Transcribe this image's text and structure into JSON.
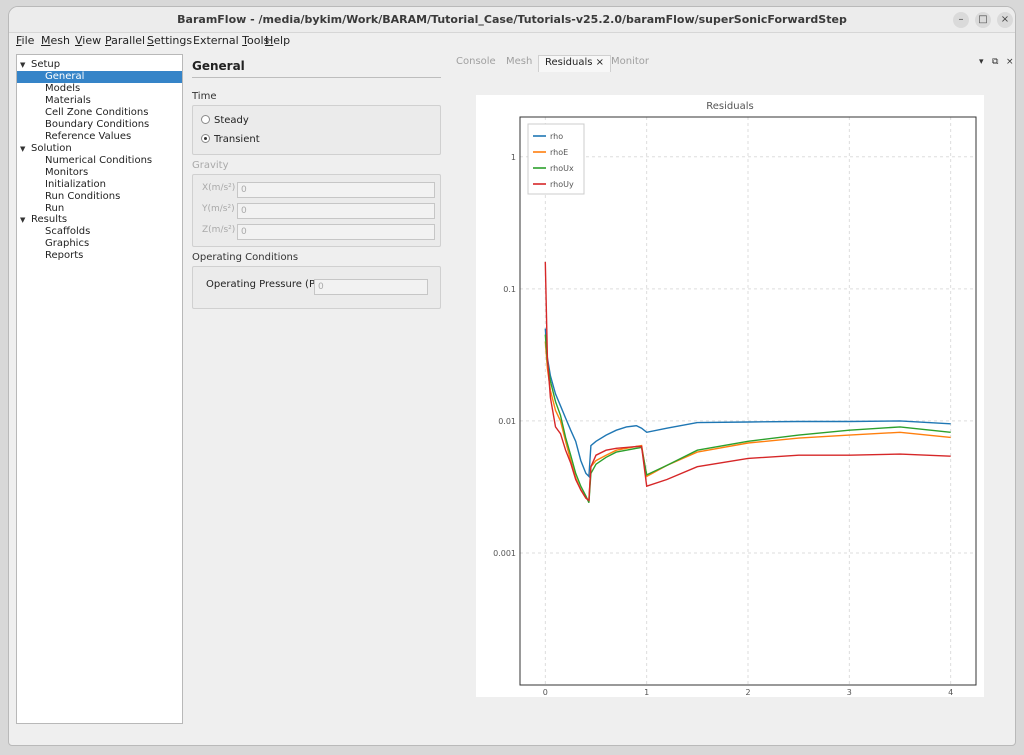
{
  "window": {
    "title": "BaramFlow - /media/bykim/Work/BARAM/Tutorial_Case/Tutorials-v25.2.0/baramFlow/superSonicForwardStep",
    "controls": {
      "minimize": "–",
      "maximize": "□",
      "close": "×"
    }
  },
  "menubar": [
    {
      "label": "File",
      "mnemonic": "F",
      "rest": "ile"
    },
    {
      "label": "Mesh",
      "mnemonic": "M",
      "rest": "esh"
    },
    {
      "label": "View",
      "mnemonic": "V",
      "rest": "iew"
    },
    {
      "label": "Parallel",
      "mnemonic": "P",
      "rest": "arallel"
    },
    {
      "label": "Settings",
      "mnemonic": "S",
      "rest": "ettings"
    },
    {
      "label": "External Tools",
      "pre": "External ",
      "mnemonic": "T",
      "rest": "ools"
    },
    {
      "label": "Help",
      "mnemonic": "H",
      "rest": "elp"
    }
  ],
  "tree": {
    "groups": [
      {
        "label": "Setup",
        "items": [
          "General",
          "Models",
          "Materials",
          "Cell Zone Conditions",
          "Boundary Conditions",
          "Reference Values"
        ]
      },
      {
        "label": "Solution",
        "items": [
          "Numerical Conditions",
          "Monitors",
          "Initialization",
          "Run Conditions",
          "Run"
        ]
      },
      {
        "label": "Results",
        "items": [
          "Scaffolds",
          "Graphics",
          "Reports"
        ]
      }
    ],
    "selected": "General"
  },
  "general": {
    "heading": "General",
    "time": {
      "label": "Time",
      "options": [
        "Steady",
        "Transient"
      ],
      "selected": "Transient"
    },
    "gravity": {
      "label": "Gravity",
      "fields": [
        {
          "label": "X(m/s²)",
          "value": "0"
        },
        {
          "label": "Y(m/s²)",
          "value": "0"
        },
        {
          "label": "Z(m/s²)",
          "value": "0"
        }
      ]
    },
    "operating": {
      "label": "Operating Conditions",
      "pressure_label": "Operating Pressure (Pa)",
      "pressure_value": "0"
    }
  },
  "tabs": {
    "items": [
      "Console",
      "Mesh",
      "Residuals",
      "Monitor"
    ],
    "active": "Residuals",
    "close_glyph": "×",
    "controls": [
      "▾",
      "⧉",
      "×"
    ]
  },
  "chart_data": {
    "type": "line",
    "title": "Residuals",
    "xlabel": "",
    "ylabel": "",
    "y_scale": "log",
    "xlim": [
      -0.25,
      4.25
    ],
    "ylim": [
      0.0001,
      2
    ],
    "x_ticks": [
      "0",
      "1",
      "2",
      "3",
      "4"
    ],
    "y_ticks": [
      "1",
      "0.1",
      "0.01",
      "0.001"
    ],
    "grid": true,
    "legend_position": "top-left",
    "series": [
      {
        "name": "rho",
        "color": "#1f77b4",
        "points": [
          [
            0,
            0.05
          ],
          [
            0.02,
            0.03
          ],
          [
            0.05,
            0.022
          ],
          [
            0.1,
            0.016
          ],
          [
            0.15,
            0.013
          ],
          [
            0.2,
            0.0105
          ],
          [
            0.25,
            0.0085
          ],
          [
            0.3,
            0.007
          ],
          [
            0.35,
            0.005
          ],
          [
            0.4,
            0.004
          ],
          [
            0.43,
            0.0038
          ],
          [
            0.45,
            0.0065
          ],
          [
            0.5,
            0.007
          ],
          [
            0.6,
            0.0078
          ],
          [
            0.7,
            0.0085
          ],
          [
            0.8,
            0.009
          ],
          [
            0.9,
            0.0092
          ],
          [
            0.95,
            0.0088
          ],
          [
            1.0,
            0.0082
          ],
          [
            1.2,
            0.0088
          ],
          [
            1.5,
            0.0097
          ],
          [
            2.0,
            0.0098
          ],
          [
            2.5,
            0.0099
          ],
          [
            3.0,
            0.0099
          ],
          [
            3.5,
            0.01
          ],
          [
            4.0,
            0.0095
          ]
        ]
      },
      {
        "name": "rhoE",
        "color": "#ff7f0e",
        "points": [
          [
            0,
            0.04
          ],
          [
            0.02,
            0.025
          ],
          [
            0.05,
            0.017
          ],
          [
            0.1,
            0.012
          ],
          [
            0.15,
            0.01
          ],
          [
            0.2,
            0.007
          ],
          [
            0.25,
            0.005
          ],
          [
            0.3,
            0.0037
          ],
          [
            0.35,
            0.003
          ],
          [
            0.4,
            0.0026
          ],
          [
            0.43,
            0.0025
          ],
          [
            0.45,
            0.0045
          ],
          [
            0.5,
            0.005
          ],
          [
            0.6,
            0.0055
          ],
          [
            0.7,
            0.006
          ],
          [
            0.8,
            0.0062
          ],
          [
            0.9,
            0.0064
          ],
          [
            0.95,
            0.0065
          ],
          [
            1.0,
            0.0038
          ],
          [
            1.2,
            0.0046
          ],
          [
            1.5,
            0.0058
          ],
          [
            2.0,
            0.0068
          ],
          [
            2.5,
            0.0074
          ],
          [
            3.0,
            0.0078
          ],
          [
            3.5,
            0.0082
          ],
          [
            4.0,
            0.0075
          ]
        ]
      },
      {
        "name": "rhoUx",
        "color": "#2ca02c",
        "points": [
          [
            0,
            0.045
          ],
          [
            0.02,
            0.028
          ],
          [
            0.05,
            0.02
          ],
          [
            0.1,
            0.014
          ],
          [
            0.15,
            0.011
          ],
          [
            0.2,
            0.0075
          ],
          [
            0.25,
            0.0055
          ],
          [
            0.3,
            0.004
          ],
          [
            0.35,
            0.0032
          ],
          [
            0.4,
            0.0027
          ],
          [
            0.43,
            0.0024
          ],
          [
            0.45,
            0.004
          ],
          [
            0.5,
            0.0047
          ],
          [
            0.6,
            0.0053
          ],
          [
            0.7,
            0.0058
          ],
          [
            0.8,
            0.006
          ],
          [
            0.9,
            0.0062
          ],
          [
            0.95,
            0.0063
          ],
          [
            1.0,
            0.0039
          ],
          [
            1.2,
            0.0046
          ],
          [
            1.5,
            0.006
          ],
          [
            2.0,
            0.007
          ],
          [
            2.5,
            0.0078
          ],
          [
            3.0,
            0.0085
          ],
          [
            3.5,
            0.009
          ],
          [
            4.0,
            0.0082
          ]
        ]
      },
      {
        "name": "rhoUy",
        "color": "#d62728",
        "points": [
          [
            0,
            0.16
          ],
          [
            0.02,
            0.03
          ],
          [
            0.05,
            0.015
          ],
          [
            0.1,
            0.009
          ],
          [
            0.15,
            0.008
          ],
          [
            0.2,
            0.006
          ],
          [
            0.25,
            0.0048
          ],
          [
            0.3,
            0.0036
          ],
          [
            0.35,
            0.003
          ],
          [
            0.4,
            0.0026
          ],
          [
            0.43,
            0.0025
          ],
          [
            0.45,
            0.0045
          ],
          [
            0.5,
            0.0055
          ],
          [
            0.6,
            0.006
          ],
          [
            0.7,
            0.0062
          ],
          [
            0.8,
            0.0063
          ],
          [
            0.9,
            0.0064
          ],
          [
            0.95,
            0.0064
          ],
          [
            1.0,
            0.0032
          ],
          [
            1.2,
            0.0036
          ],
          [
            1.5,
            0.0045
          ],
          [
            2.0,
            0.0052
          ],
          [
            2.5,
            0.0055
          ],
          [
            3.0,
            0.0055
          ],
          [
            3.5,
            0.0056
          ],
          [
            4.0,
            0.0054
          ]
        ]
      }
    ]
  }
}
